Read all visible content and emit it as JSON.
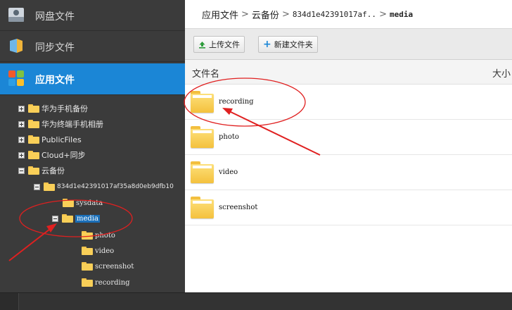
{
  "sidebar": {
    "nav": [
      {
        "label": "网盘文件",
        "icon": "drive-icon"
      },
      {
        "label": "同步文件",
        "icon": "sync-icon"
      },
      {
        "label": "应用文件",
        "icon": "apps-icon"
      }
    ],
    "tree": [
      {
        "label": "华为手机备份",
        "toggle": "plus"
      },
      {
        "label": "华为终端手机相册",
        "toggle": "plus"
      },
      {
        "label": "PublicFiles",
        "toggle": "plus"
      },
      {
        "label": "Cloud+同步",
        "toggle": "plus"
      },
      {
        "label": "云备份",
        "toggle": "minus"
      },
      {
        "label": "834d1e42391017af35a8d0eb9dfb10",
        "toggle": "minus"
      },
      {
        "label": "sysdata",
        "toggle": "none"
      },
      {
        "label": "media",
        "toggle": "minus",
        "selected": true
      },
      {
        "label": "photo",
        "toggle": "none"
      },
      {
        "label": "video",
        "toggle": "none"
      },
      {
        "label": "screenshot",
        "toggle": "none"
      },
      {
        "label": "recording",
        "toggle": "none"
      }
    ]
  },
  "breadcrumb": {
    "root": "应用文件",
    "cloud": "云备份",
    "hash": "834d1e42391017af..",
    "current": "media",
    "separator": ">"
  },
  "toolbar": {
    "upload": {
      "label": "上传文件",
      "icon": "upload-icon"
    },
    "new_folder": {
      "label": "新建文件夹",
      "icon": "plus-icon"
    }
  },
  "table": {
    "col_name": "文件名",
    "col_size": "大小",
    "rows": [
      {
        "name": "recording"
      },
      {
        "name": "photo"
      },
      {
        "name": "video"
      },
      {
        "name": "screenshot"
      }
    ]
  },
  "colors": {
    "sidebar_bg": "#3b3b3b",
    "active_blue": "#1b86d6",
    "annotation_red": "#e02020",
    "folder_yellow": "#f9cf58"
  }
}
